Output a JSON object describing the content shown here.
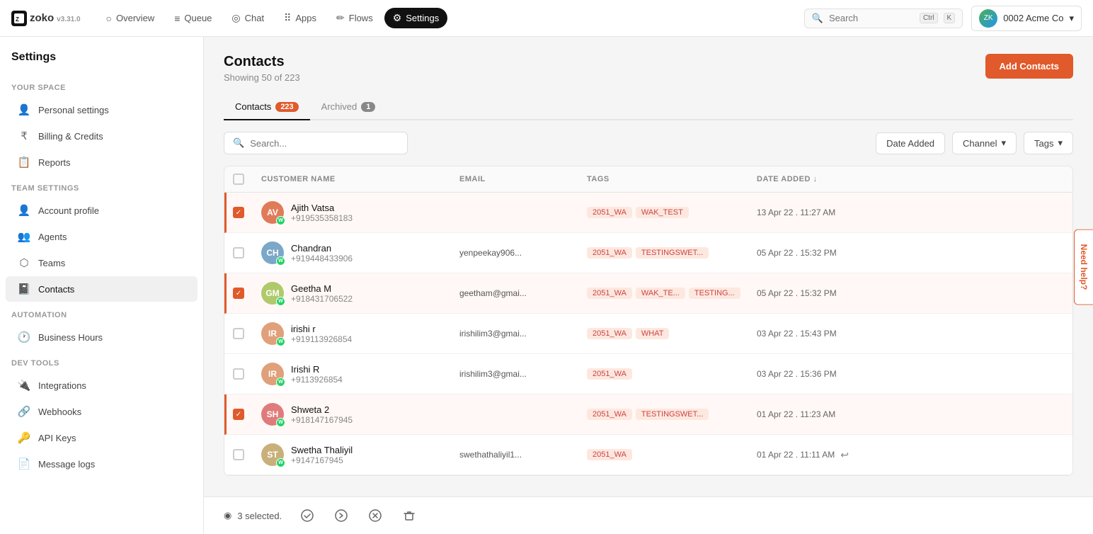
{
  "app": {
    "name": "zoko",
    "version": "v3.31.0"
  },
  "topnav": {
    "items": [
      {
        "id": "overview",
        "label": "Overview",
        "icon": "○",
        "active": false
      },
      {
        "id": "queue",
        "label": "Queue",
        "icon": "≡",
        "active": false
      },
      {
        "id": "chat",
        "label": "Chat",
        "icon": "◎",
        "active": false
      },
      {
        "id": "apps",
        "label": "Apps",
        "icon": "⠿",
        "active": false
      },
      {
        "id": "flows",
        "label": "Flows",
        "icon": "✏",
        "active": false
      },
      {
        "id": "settings",
        "label": "Settings",
        "icon": "⚙",
        "active": true
      }
    ],
    "search_placeholder": "Search",
    "kbd1": "Ctrl",
    "kbd2": "K",
    "workspace": "0002 Acme Co"
  },
  "sidebar": {
    "title": "Settings",
    "your_space_label": "YOUR SPACE",
    "team_settings_label": "TEAM SETTINGS",
    "automation_label": "AUTOMATION",
    "dev_tools_label": "DEV TOOLS",
    "your_space_items": [
      {
        "id": "personal-settings",
        "label": "Personal settings",
        "icon": "👤"
      },
      {
        "id": "billing-credits",
        "label": "Billing & Credits",
        "icon": "₹"
      },
      {
        "id": "reports",
        "label": "Reports",
        "icon": "📋"
      }
    ],
    "team_settings_items": [
      {
        "id": "account-profile",
        "label": "Account profile",
        "icon": "👤"
      },
      {
        "id": "agents",
        "label": "Agents",
        "icon": "👥"
      },
      {
        "id": "teams",
        "label": "Teams",
        "icon": "⬡"
      },
      {
        "id": "contacts",
        "label": "Contacts",
        "icon": "📓",
        "active": true
      }
    ],
    "automation_items": [
      {
        "id": "business-hours",
        "label": "Business Hours",
        "icon": "🕐"
      }
    ],
    "dev_tools_items": [
      {
        "id": "integrations",
        "label": "Integrations",
        "icon": "🔌"
      },
      {
        "id": "webhooks",
        "label": "Webhooks",
        "icon": "🔗"
      },
      {
        "id": "api-keys",
        "label": "API Keys",
        "icon": "🔑"
      },
      {
        "id": "message-logs",
        "label": "Message logs",
        "icon": "📄"
      }
    ]
  },
  "contacts_page": {
    "title": "Contacts",
    "subtitle": "Showing 50 of 223",
    "add_btn": "Add Contacts",
    "tabs": [
      {
        "id": "contacts",
        "label": "Contacts",
        "badge": "223",
        "active": true
      },
      {
        "id": "archived",
        "label": "Archived",
        "badge": "1",
        "active": false
      }
    ],
    "search_placeholder": "Search...",
    "filter_date": "Date Added",
    "filter_channel": "Channel",
    "filter_tags": "Tags",
    "table": {
      "headers": [
        {
          "id": "checkbox",
          "label": ""
        },
        {
          "id": "customer-name",
          "label": "CUSTOMER NAME"
        },
        {
          "id": "email",
          "label": "EMAIL"
        },
        {
          "id": "tags",
          "label": "TAGS"
        },
        {
          "id": "date-added",
          "label": "DATE ADDED ↓"
        }
      ],
      "rows": [
        {
          "id": 1,
          "selected": true,
          "avatar_initials": "AV",
          "avatar_color": "#e07b5a",
          "name": "Ajith Vatsa",
          "phone": "+919535358183",
          "email": "",
          "tags": [
            "2051_WA",
            "WAK_TEST"
          ],
          "date": "13 Apr 22 . 11:27 AM",
          "has_whatsapp": true
        },
        {
          "id": 2,
          "selected": false,
          "avatar_initials": "CH",
          "avatar_color": "#7ba7c9",
          "name": "Chandran",
          "phone": "+919448433906",
          "email": "yenpeekay906...",
          "tags": [
            "2051_WA",
            "TESTINGSWET..."
          ],
          "date": "05 Apr 22 . 15:32 PM",
          "has_whatsapp": true
        },
        {
          "id": 3,
          "selected": true,
          "avatar_initials": "GM",
          "avatar_color": "#b0c96a",
          "name": "Geetha M",
          "phone": "+918431706522",
          "email": "geetham@gmai...",
          "tags": [
            "2051_WA",
            "WAK_TE...",
            "TESTING..."
          ],
          "date": "05 Apr 22 . 15:32 PM",
          "has_whatsapp": true
        },
        {
          "id": 4,
          "selected": false,
          "avatar_initials": "IR",
          "avatar_color": "#e0a07a",
          "name": "irishi r",
          "phone": "+919113926854",
          "email": "irishilim3@gmai...",
          "tags": [
            "2051_WA",
            "WHAT"
          ],
          "date": "03 Apr 22 . 15:43 PM",
          "has_whatsapp": true
        },
        {
          "id": 5,
          "selected": false,
          "avatar_initials": "IR",
          "avatar_color": "#e0a07a",
          "name": "Irishi R",
          "phone": "+9113926854",
          "email": "irishilim3@gmai...",
          "tags": [
            "2051_WA"
          ],
          "date": "03 Apr 22 . 15:36 PM",
          "has_whatsapp": true
        },
        {
          "id": 6,
          "selected": true,
          "avatar_initials": "SH",
          "avatar_color": "#e07b7b",
          "name": "Shweta 2",
          "phone": "+918147167945",
          "email": "",
          "tags": [
            "2051_WA",
            "TESTINGSWET..."
          ],
          "date": "01 Apr 22 . 11:23 AM",
          "has_whatsapp": true
        },
        {
          "id": 7,
          "selected": false,
          "avatar_initials": "ST",
          "avatar_color": "#c9b07a",
          "name": "Swetha Thaliyil",
          "phone": "+9147167945",
          "email": "swethathaliyil1...",
          "tags": [
            "2051_WA"
          ],
          "date": "01 Apr 22 . 11:11 AM",
          "has_whatsapp": true,
          "has_action": true
        }
      ]
    },
    "bottom_bar": {
      "selected_label": "3 selected.",
      "actions": [
        "✓",
        "→",
        "✗",
        "🗑"
      ]
    }
  },
  "help_widget": "Need help?"
}
